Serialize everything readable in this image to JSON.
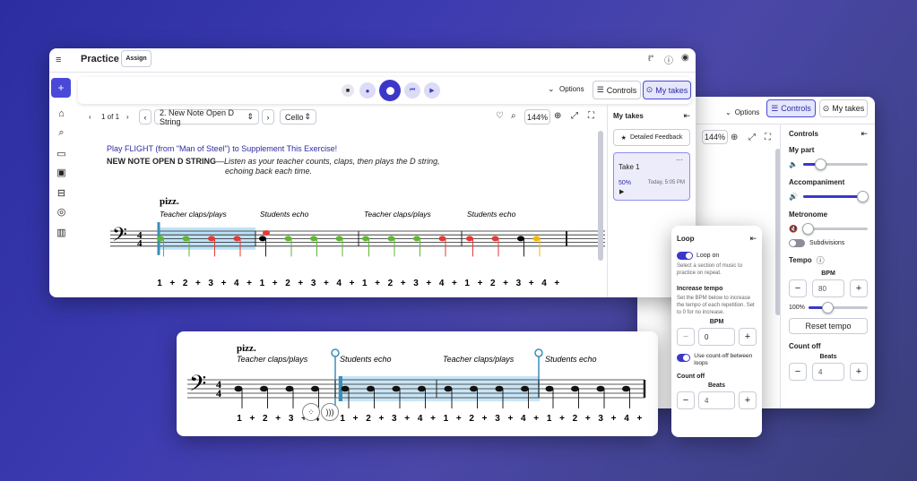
{
  "app": {
    "title": "Practice",
    "assign_label": "Assign",
    "options_label": "Options",
    "controls_label": "Controls",
    "my_takes_label": "My takes"
  },
  "sidebar": {
    "icons": [
      "menu-icon",
      "plus-icon",
      "home-icon",
      "search-icon",
      "folder-icon",
      "play-screen-icon",
      "library-icon",
      "eye-icon",
      "books-icon"
    ]
  },
  "score_toolbar": {
    "page": "1 of 1",
    "exercise": "2. New Note Open D String",
    "instrument": "Cello",
    "zoom": "144%"
  },
  "score": {
    "instruction": "Play FLIGHT (from \"Man of Steel\") to Supplement This Exercise!",
    "heading_bold": "NEW NOTE OPEN D STRING",
    "heading_italic": "—Listen as your teacher counts, claps, then plays the D string,",
    "heading_italic2": "echoing back each time.",
    "pizz": "pizz.",
    "sections": [
      "Teacher claps/plays",
      "Students echo",
      "Teacher claps/plays",
      "Students echo"
    ],
    "counts": [
      "1",
      "+",
      "2",
      "+",
      "3",
      "+",
      "4",
      "+",
      "1",
      "+",
      "2",
      "+",
      "3",
      "+",
      "4",
      "+",
      "1",
      "+",
      "2",
      "+",
      "3",
      "+",
      "4",
      "+",
      "1",
      "+",
      "2",
      "+",
      "3",
      "+",
      "4",
      "+"
    ]
  },
  "takes_panel": {
    "title": "My takes",
    "feedback_label": "Detailed Feedback",
    "take_name": "Take 1",
    "take_score": "50%",
    "take_time": "Today, 5:05 PM"
  },
  "controls_panel": {
    "options_label": "Options",
    "controls_label": "Controls",
    "my_takes_label": "My takes",
    "zoom": "144%",
    "title": "Controls",
    "my_part": "My part",
    "my_part_level": 0.25,
    "accompaniment": "Accompaniment",
    "accompaniment_level": 0.9,
    "metronome": "Metronome",
    "metronome_level": 0.05,
    "subdivisions": "Subdivisions",
    "tempo": "Tempo",
    "bpm_label": "BPM",
    "bpm_value": "80",
    "tempo_pct": "100%",
    "tempo_level": 0.3,
    "reset_tempo": "Reset tempo",
    "count_off": "Count off",
    "beats_label": "Beats",
    "beats_value": "4"
  },
  "loop_panel": {
    "title": "Loop",
    "loop_on": "Loop on",
    "loop_desc": "Select a section of music to practice on repeat.",
    "increase_tempo": "Increase tempo",
    "increase_desc": "Set the BPM below to increase the tempo of each repetition. Set to 0 for no increase.",
    "bpm_label": "BPM",
    "bpm_value": "0",
    "count_off_toggle": "Use count-off between loops",
    "count_off": "Count off",
    "beats_label": "Beats",
    "beats_value": "4"
  },
  "loop_score": {
    "pizz": "pizz.",
    "sections": [
      "Teacher claps/plays",
      "Students echo",
      "Teacher claps/plays",
      "Students echo"
    ],
    "counts": [
      "1",
      "+",
      "2",
      "+",
      "3",
      "+",
      "4",
      "+",
      "1",
      "+",
      "2",
      "+",
      "3",
      "+",
      "4",
      "+",
      "1",
      "+",
      "2",
      "+",
      "3",
      "+",
      "4",
      "+",
      "1",
      "+",
      "2",
      "+",
      "3",
      "+",
      "4",
      "+"
    ]
  },
  "colors": {
    "accent": "#3b38c9",
    "note_green": "#5cb82e",
    "note_red": "#e53935",
    "note_yellow": "#f5b800",
    "highlight": "#bfe1f5"
  }
}
